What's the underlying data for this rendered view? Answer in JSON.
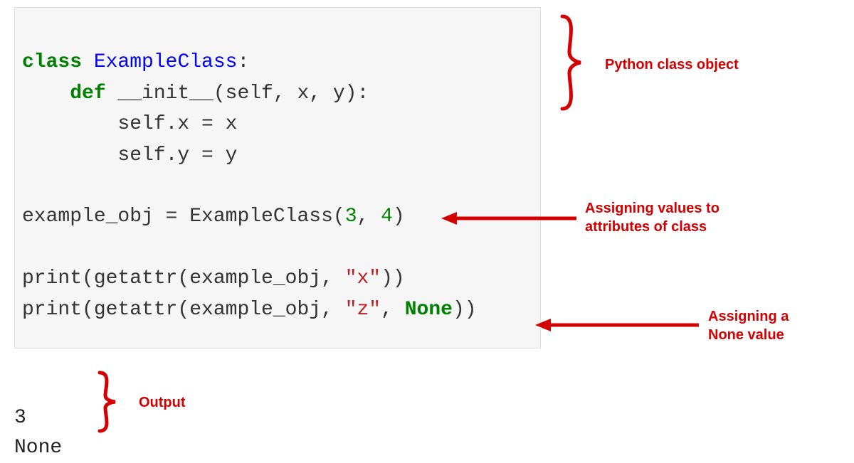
{
  "code": {
    "line1_kw": "class",
    "line1_cls": " ExampleClass",
    "line1_colon": ":",
    "line2_kw": "    def",
    "line2_rest": " __init__(self, x, y):",
    "line3": "        self.x = x",
    "line4": "        self.y = y",
    "blank1": " ",
    "line5_left": "example_obj = ExampleClass(",
    "line5_n3": "3",
    "line5_mid": ", ",
    "line5_n4": "4",
    "line5_right": ")",
    "blank2": " ",
    "line6_print": "print(getattr(example_obj, ",
    "line6_str": "\"x\"",
    "line6_end": "))",
    "line7_print": "print(getattr(example_obj, ",
    "line7_str": "\"z\"",
    "line7_mid": ", ",
    "line7_none": "None",
    "line7_end": "))"
  },
  "output": {
    "line1": "3",
    "line2": "None"
  },
  "annotations": {
    "class_obj": "Python class object",
    "assign_values_l1": "Assigning values to",
    "assign_values_l2": "attributes of class",
    "assign_none_l1": "Assigning a",
    "assign_none_l2": "None value",
    "output": "Output"
  }
}
